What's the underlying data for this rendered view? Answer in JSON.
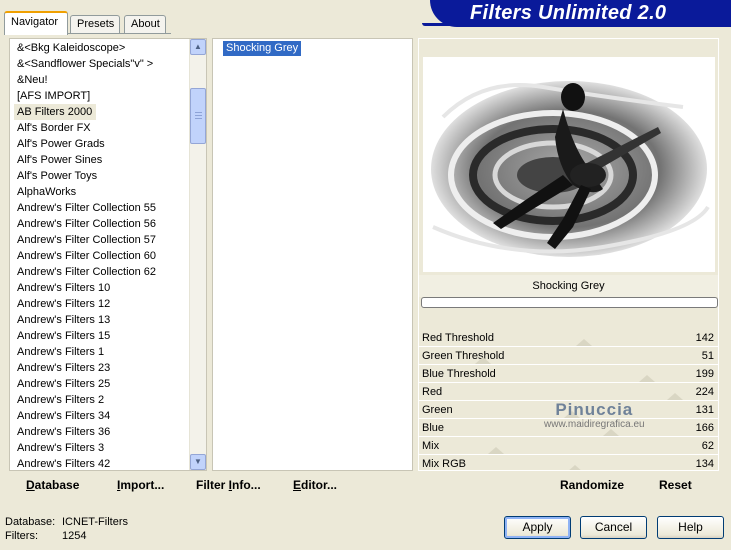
{
  "tabs": [
    {
      "label": "Navigator"
    },
    {
      "label": "Presets"
    },
    {
      "label": "About"
    }
  ],
  "banner": {
    "title": "Filters Unlimited 2.0"
  },
  "categories": [
    "&<Bkg Kaleidoscope>",
    "&<Sandflower Specials\"v\" >",
    "&Neu!",
    "[AFS IMPORT]",
    "AB Filters 2000",
    "Alf's Border FX",
    "Alf's Power Grads",
    "Alf's Power Sines",
    "Alf's Power Toys",
    "AlphaWorks",
    "Andrew's Filter Collection 55",
    "Andrew's Filter Collection 56",
    "Andrew's Filter Collection 57",
    "Andrew's Filter Collection 60",
    "Andrew's Filter Collection 62",
    "Andrew's Filters 10",
    "Andrew's Filters 12",
    "Andrew's Filters 13",
    "Andrew's Filters 15",
    "Andrew's Filters 1",
    "Andrew's Filters 23",
    "Andrew's Filters 25",
    "Andrew's Filters 2",
    "Andrew's Filters 34",
    "Andrew's Filters 36",
    "Andrew's Filters 3",
    "Andrew's Filters 42"
  ],
  "selected_category_index": 4,
  "filters": [
    "Shocking Grey"
  ],
  "preview": {
    "title": "Shocking Grey"
  },
  "sliders": [
    {
      "label": "Red Threshold",
      "value": "142",
      "max": 255
    },
    {
      "label": "Green Threshold",
      "value": "51",
      "max": 255
    },
    {
      "label": "Blue Threshold",
      "value": "199",
      "max": 255
    },
    {
      "label": "Red",
      "value": "224",
      "max": 255
    },
    {
      "label": "Green",
      "value": "131",
      "max": 255
    },
    {
      "label": "Blue",
      "value": "166",
      "max": 255
    },
    {
      "label": "Mix",
      "value": "62",
      "max": 255
    },
    {
      "label": "Mix RGB",
      "value": "134",
      "max": 255
    }
  ],
  "watermark": {
    "line1": "Pinuccia",
    "line2": "www.maidiregrafica.eu"
  },
  "toolbar": {
    "database_u": "D",
    "database_rest": "atabase",
    "import_u": "I",
    "import_rest": "mport...",
    "filterinfo_pre": "Filter ",
    "filterinfo_u": "I",
    "filterinfo_rest": "nfo...",
    "editor_u": "E",
    "editor_rest": "ditor...",
    "randomize": "Randomize",
    "reset": "Reset"
  },
  "info": {
    "database_key": "Database:",
    "database_val": "ICNET-Filters",
    "filters_key": "Filters:",
    "filters_val": "1254"
  },
  "buttons": {
    "apply": "Apply",
    "cancel": "Cancel",
    "help": "Help"
  },
  "colors": {
    "selection": "#316ac5",
    "banner": "#0a1a9a",
    "dialog_bg": "#ece9d8"
  }
}
